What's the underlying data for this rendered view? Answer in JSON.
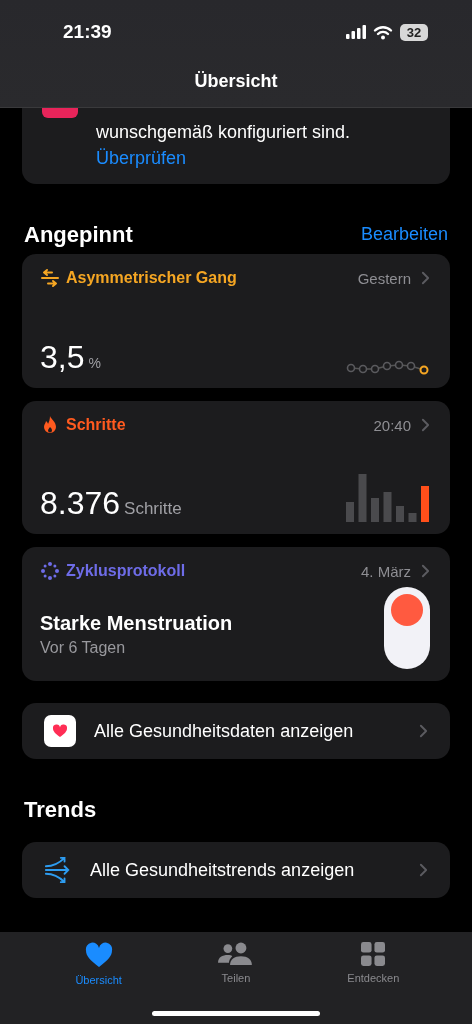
{
  "status_bar": {
    "time": "21:39",
    "battery": "32"
  },
  "nav": {
    "title": "Übersicht"
  },
  "notice": {
    "lines": [
      "wunschgemäß konfiguriert sind."
    ],
    "link": "Überprüfen"
  },
  "pinned": {
    "title": "Angepinnt",
    "action": "Bearbeiten"
  },
  "cards": [
    {
      "kind": "gait",
      "title": "Asymmetrischer Gang",
      "time": "Gestern",
      "value": "3,5",
      "unit": "%"
    },
    {
      "kind": "steps",
      "title": "Schritte",
      "time": "20:40",
      "value": "8.376",
      "unit": "Schritte"
    },
    {
      "kind": "cycle",
      "title": "Zyklusprotokoll",
      "time": "4. März",
      "value": "Starke Menstruation",
      "subtitle": "Vor 6 Tagen"
    }
  ],
  "all_data": {
    "label": "Alle Gesundheitsdaten anzeigen"
  },
  "trends": {
    "title": "Trends",
    "row": "Alle Gesundheitstrends anzeigen"
  },
  "tab_bar": [
    {
      "label": "Übersicht",
      "kind": "heart",
      "selected": true
    },
    {
      "label": "Teilen",
      "kind": "people",
      "selected": false
    },
    {
      "label": "Entdecken",
      "kind": "grid",
      "selected": false
    }
  ]
}
